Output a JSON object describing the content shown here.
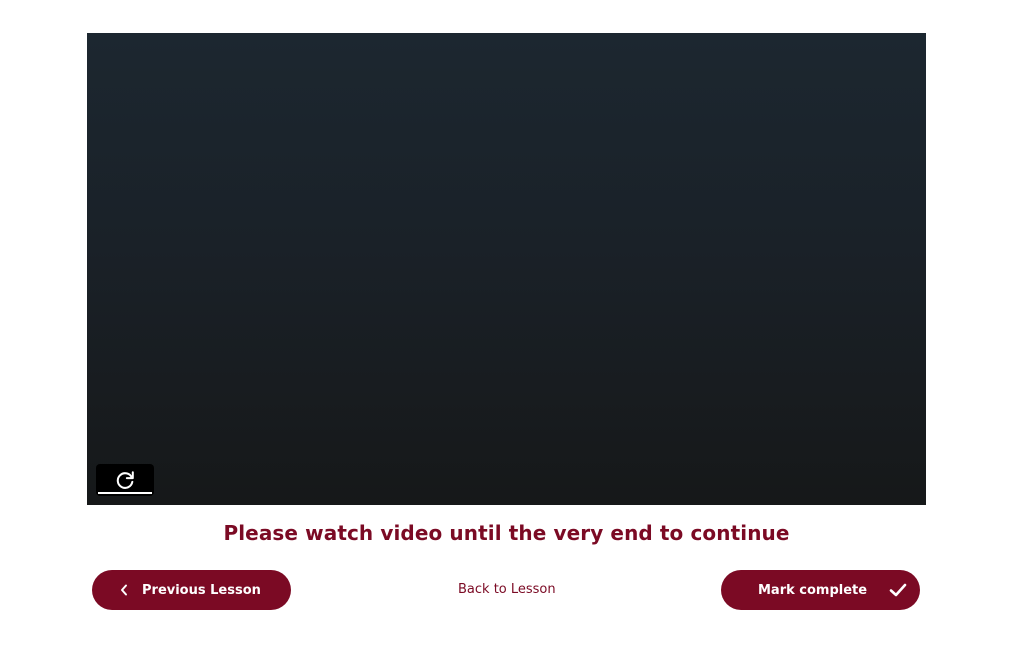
{
  "video": {
    "replay_icon": "replay-icon"
  },
  "message": "Please watch video until the very end to continue",
  "nav": {
    "previous_label": "Previous Lesson",
    "back_label": "Back to Lesson",
    "complete_label": "Mark complete"
  },
  "colors": {
    "accent": "#7b0a24",
    "video_bg": "#1a2128"
  }
}
